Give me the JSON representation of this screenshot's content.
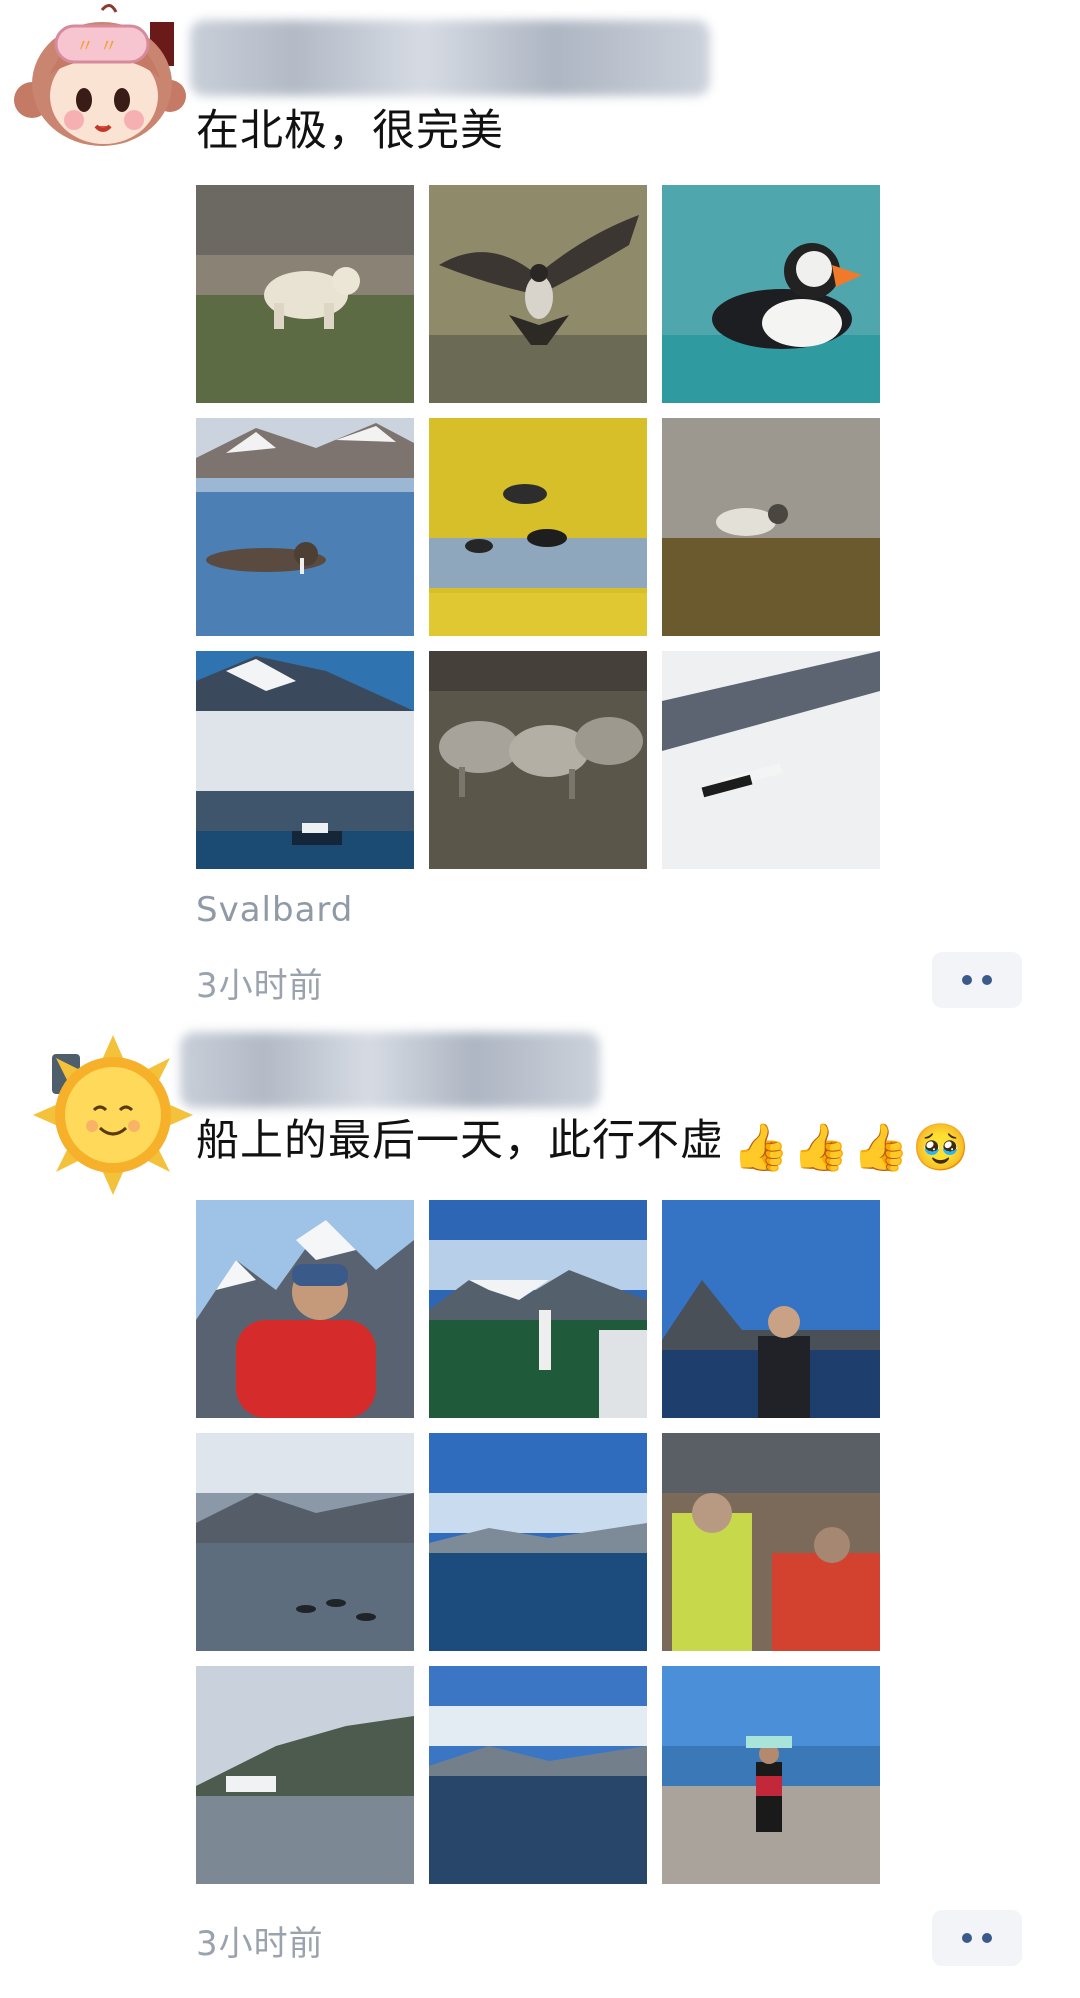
{
  "posts": [
    {
      "text": "在北极，很完美",
      "location": "Svalbard",
      "timestamp": "3小时前",
      "emojis": [],
      "photos": [
        {
          "subject": "polar bear on tundra"
        },
        {
          "subject": "bird spreading wings"
        },
        {
          "subject": "puffin on water"
        },
        {
          "subject": "walruses in sea"
        },
        {
          "subject": "geese on yellow moss"
        },
        {
          "subject": "arctic fox on rocks"
        },
        {
          "subject": "mountains and ship in fog"
        },
        {
          "subject": "reindeer herd"
        },
        {
          "subject": "person lying in snow"
        }
      ]
    },
    {
      "text": "船上的最后一天，此行不虚",
      "timestamp": "3小时前",
      "emojis": [
        "👍",
        "👍",
        "👍",
        "🥹"
      ],
      "photos": [
        {
          "subject": "man in red jacket with mountains"
        },
        {
          "subject": "ship deck with mountains"
        },
        {
          "subject": "man on deck by the sea"
        },
        {
          "subject": "fjord with small boats"
        },
        {
          "subject": "blue fjord and sky"
        },
        {
          "subject": "people in ship lounge"
        },
        {
          "subject": "ship in harbor"
        },
        {
          "subject": "calm bay with snowy hills"
        },
        {
          "subject": "person on pebble beach with sign"
        }
      ]
    }
  ],
  "icons": {
    "avatar1": "cartoon-girl-avatar",
    "avatar2": "smiling-sun-avatar",
    "more": "more-dots-icon"
  }
}
